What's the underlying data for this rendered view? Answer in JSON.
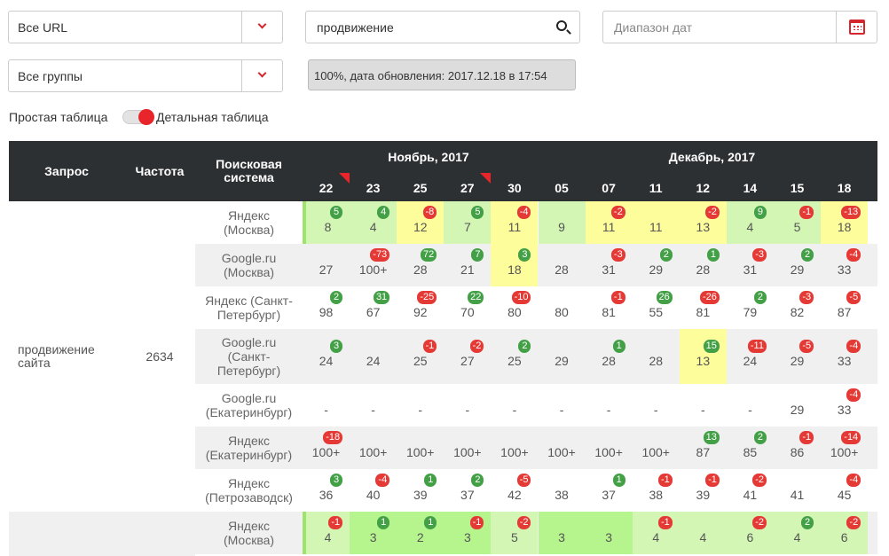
{
  "filters": {
    "url_select": "Все URL",
    "group_select": "Все группы",
    "search_value": "продвижение",
    "date_placeholder": "Диапазон дат",
    "status": "100%, дата обновления: 2017.12.18 в 17:54"
  },
  "view_toggle": {
    "simple": "Простая таблица",
    "detailed": "Детальная таблица"
  },
  "table": {
    "headers": {
      "query": "Запрос",
      "frequency": "Частота",
      "engine": "Поисковая система"
    },
    "months": [
      "Ноябрь, 2017",
      "Декабрь, 2017"
    ],
    "dates": [
      "22",
      "23",
      "25",
      "27",
      "30",
      "05",
      "07",
      "11",
      "12",
      "14",
      "15",
      "18"
    ],
    "query": "продвижение сайта",
    "frequency": "2634",
    "rows": [
      {
        "engine": "Яндекс (Москва)",
        "values": [
          "8",
          "4",
          "12",
          "7",
          "11",
          "9",
          "11",
          "11",
          "13",
          "4",
          "5",
          "18"
        ],
        "deltas": [
          "5",
          "4",
          "-8",
          "5",
          "-4",
          "",
          "-2",
          "",
          "-2",
          "9",
          "-1",
          "-13"
        ]
      },
      {
        "engine": "Google.ru (Москва)",
        "values": [
          "27",
          "100+",
          "28",
          "21",
          "18",
          "28",
          "31",
          "29",
          "28",
          "31",
          "29",
          "33"
        ],
        "deltas": [
          "",
          "-73",
          "72",
          "7",
          "3",
          "",
          "-3",
          "2",
          "1",
          "-3",
          "2",
          "-4"
        ]
      },
      {
        "engine": "Яндекс (Санкт-Петербург)",
        "values": [
          "98",
          "67",
          "92",
          "70",
          "80",
          "80",
          "81",
          "55",
          "81",
          "79",
          "82",
          "87"
        ],
        "deltas": [
          "2",
          "31",
          "-25",
          "22",
          "-10",
          "",
          "-1",
          "26",
          "-26",
          "2",
          "-3",
          "-5"
        ]
      },
      {
        "engine": "Google.ru (Санкт-Петербург)",
        "values": [
          "24",
          "24",
          "25",
          "27",
          "25",
          "29",
          "28",
          "28",
          "13",
          "24",
          "29",
          "33"
        ],
        "deltas": [
          "3",
          "",
          "-1",
          "-2",
          "2",
          "",
          "1",
          "",
          "15",
          "-11",
          "-5",
          "-4"
        ]
      },
      {
        "engine": "Google.ru (Екатеринбург)",
        "values": [
          "-",
          "-",
          "-",
          "-",
          "-",
          "-",
          "-",
          "-",
          "-",
          "-",
          "29",
          "33"
        ],
        "deltas": [
          "",
          "",
          "",
          "",
          "",
          "",
          "",
          "",
          "",
          "",
          "",
          "-4"
        ]
      },
      {
        "engine": "Яндекс (Екатеринбург)",
        "values": [
          "100+",
          "100+",
          "100+",
          "100+",
          "100+",
          "100+",
          "100+",
          "100+",
          "87",
          "85",
          "86",
          "100+"
        ],
        "deltas": [
          "-18",
          "",
          "",
          "",
          "",
          "",
          "",
          "",
          "13",
          "2",
          "-1",
          "-14"
        ]
      },
      {
        "engine": "Яндекс (Петрозаводск)",
        "values": [
          "36",
          "40",
          "39",
          "37",
          "42",
          "38",
          "37",
          "38",
          "39",
          "41",
          "41",
          "45"
        ],
        "deltas": [
          "3",
          "-4",
          "1",
          "2",
          "-5",
          "",
          "1",
          "-1",
          "-1",
          "-2",
          "",
          "-4"
        ]
      },
      {
        "engine": "Яндекс (Москва)",
        "values": [
          "4",
          "3",
          "2",
          "3",
          "5",
          "3",
          "3",
          "4",
          "4",
          "6",
          "4",
          "6"
        ],
        "deltas": [
          "-1",
          "1",
          "1",
          "-1",
          "-2",
          "",
          "",
          "-1",
          "",
          "-2",
          "2",
          "-2"
        ]
      }
    ]
  },
  "colors": {
    "positive": "#43a047",
    "negative": "#e53935",
    "header_bg": "#2d3033",
    "accent": "#e8252b",
    "yellow": "#fdfd9b",
    "light_green": "#d3f6b5",
    "green": "#b6f48e"
  }
}
